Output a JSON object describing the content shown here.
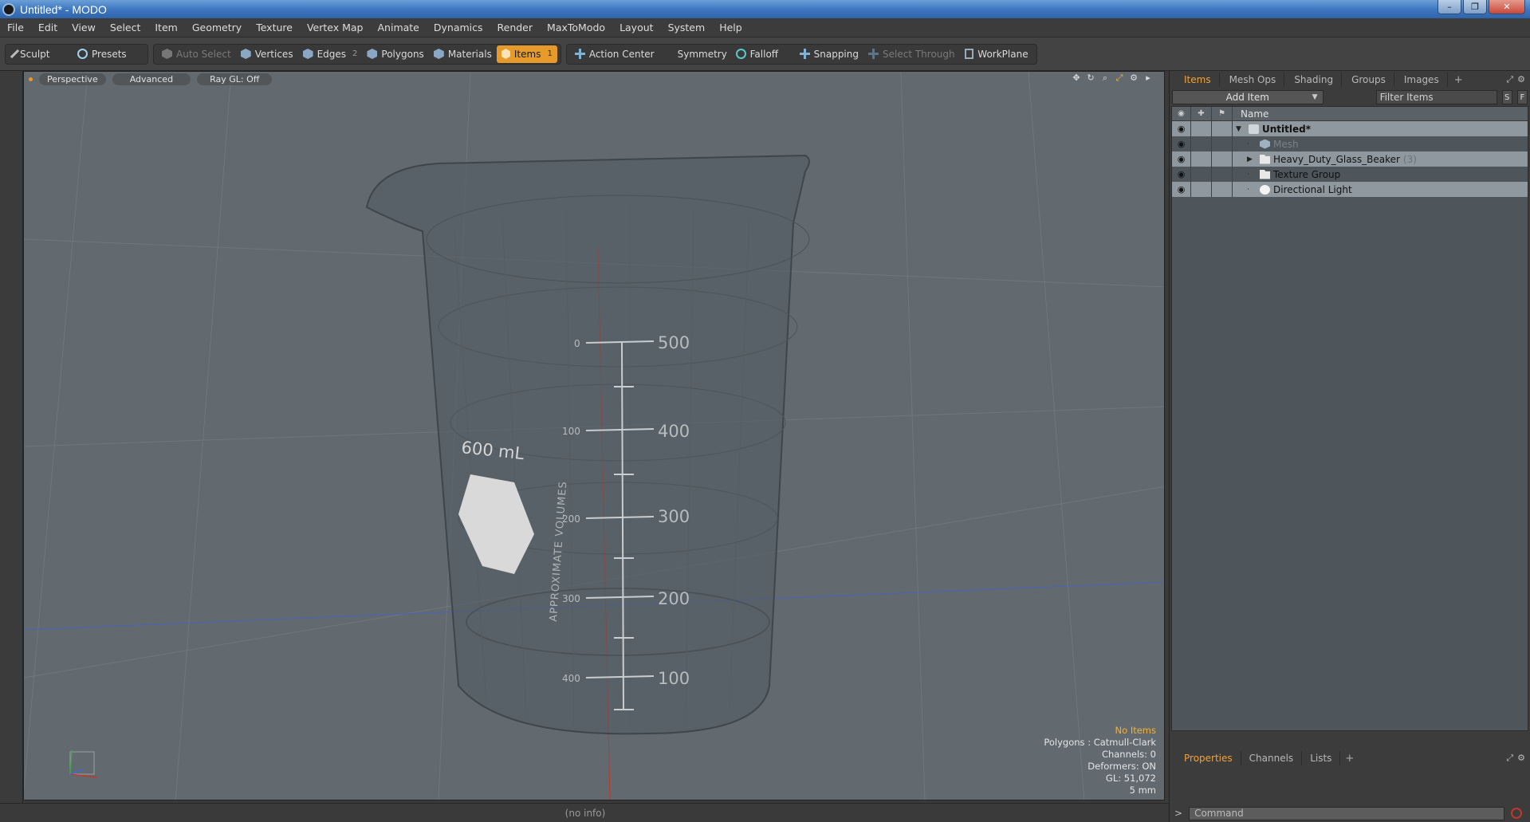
{
  "window": {
    "title": "Untitled* - MODO",
    "controls": [
      "–",
      "❐",
      "✕"
    ]
  },
  "menu": [
    "File",
    "Edit",
    "View",
    "Select",
    "Item",
    "Geometry",
    "Texture",
    "Vertex Map",
    "Animate",
    "Dynamics",
    "Render",
    "MaxToModo",
    "Layout",
    "System",
    "Help"
  ],
  "toolbar": {
    "sculpt": "Sculpt",
    "presets": "Presets",
    "auto_select": "Auto Select",
    "vertices": "Vertices",
    "edges": "Edges",
    "edges_count": "2",
    "polygons": "Polygons",
    "materials": "Materials",
    "items": "Items",
    "items_count": "1",
    "action_center": "Action Center",
    "symmetry": "Symmetry",
    "falloff": "Falloff",
    "snapping": "Snapping",
    "select_through": "Select Through",
    "workplane": "WorkPlane"
  },
  "viewport": {
    "view": "Perspective",
    "mode": "Advanced",
    "raygl": "Ray GL: Off",
    "beaker": {
      "capacity_label": "600 mL",
      "vertical_text": "APPROXIMATE  VOLUMES",
      "left_scale": [
        "0",
        "100",
        "200",
        "300",
        "400"
      ],
      "right_scale": [
        "500",
        "400",
        "300",
        "200",
        "100"
      ]
    },
    "info": {
      "selection": "No Items",
      "polygons": "Polygons : Catmull-Clark",
      "channels": "Channels: 0",
      "deformers": "Deformers: ON",
      "gl": "GL: 51,072",
      "scale": "5 mm"
    }
  },
  "status": "(no info)",
  "right_panel": {
    "tabs": [
      "Items",
      "Mesh Ops",
      "Shading",
      "Groups",
      "Images"
    ],
    "add_item": "Add Item",
    "filter_placeholder": "Filter Items",
    "s_btn": "S",
    "f_btn": "F",
    "column_name": "Name",
    "tree": [
      {
        "label": "Untitled*",
        "type": "scene",
        "count": ""
      },
      {
        "label": "Mesh",
        "type": "mesh",
        "count": ""
      },
      {
        "label": "Heavy_Duty_Glass_Beaker",
        "type": "folder",
        "count": "(3)"
      },
      {
        "label": "Texture Group",
        "type": "folder",
        "count": ""
      },
      {
        "label": "Directional Light",
        "type": "light",
        "count": ""
      }
    ],
    "bottom_tabs": [
      "Properties",
      "Channels",
      "Lists"
    ],
    "command_placeholder": "Command",
    "command_prompt": ">"
  }
}
